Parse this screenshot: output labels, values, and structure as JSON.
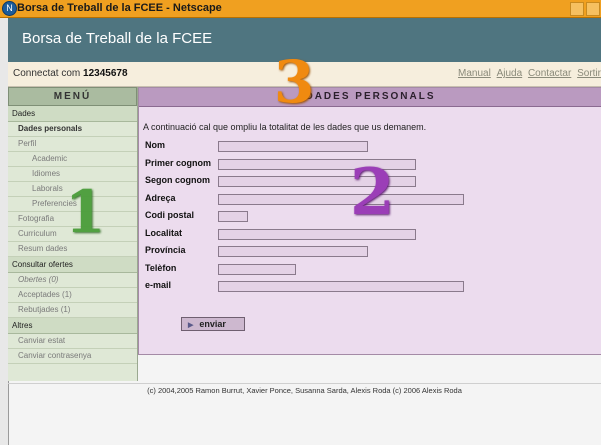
{
  "window": {
    "title": "Borsa de Treball de la FCEE - Netscape"
  },
  "app": {
    "title": "Borsa de Treball de la FCEE"
  },
  "infobar": {
    "connected_label": "Connectat com",
    "user_id": "12345678",
    "links": [
      "Manual",
      "Ajuda",
      "Contactar",
      "Sortir"
    ]
  },
  "sidebar": {
    "title": "MENÚ",
    "sections": [
      {
        "label": "Dades",
        "items": [
          {
            "label": "Dades personals",
            "level": 1,
            "active": true
          },
          {
            "label": "Perfil",
            "level": 1
          },
          {
            "label": "Academic",
            "level": 2
          },
          {
            "label": "Idiomes",
            "level": 2
          },
          {
            "label": "Laborals",
            "level": 2
          },
          {
            "label": "Preferencies",
            "level": 2
          },
          {
            "label": "Fotografia",
            "level": 1
          },
          {
            "label": "Curriculum",
            "level": 1
          },
          {
            "label": "Resum dades",
            "level": 1
          }
        ]
      },
      {
        "label": "Consultar ofertes",
        "items": [
          {
            "label": "Obertes (0)",
            "level": 1,
            "italic": true
          },
          {
            "label": "Acceptades (1)",
            "level": 1
          },
          {
            "label": "Rebutjades (1)",
            "level": 1
          }
        ]
      },
      {
        "label": "Altres",
        "items": [
          {
            "label": "Canviar estat",
            "level": 1
          },
          {
            "label": "Canviar contrasenya",
            "level": 1
          }
        ]
      }
    ]
  },
  "main": {
    "heading": "DADES PERSONALS",
    "intro": "A continuació cal que ompliu la totalitat de les dades que us demanem.",
    "fields": [
      {
        "label": "Nom",
        "value": ""
      },
      {
        "label": "Primer cognom",
        "value": ""
      },
      {
        "label": "Segon cognom",
        "value": ""
      },
      {
        "label": "Adreça",
        "value": ""
      },
      {
        "label": "Codi postal",
        "value": ""
      },
      {
        "label": "Localitat",
        "value": ""
      },
      {
        "label": "Província",
        "value": ""
      },
      {
        "label": "Telèfon",
        "value": ""
      },
      {
        "label": "e-mail",
        "value": ""
      }
    ],
    "submit_label": "enviar"
  },
  "footer": {
    "text": "(c) 2004,2005 Ramon Burrut, Xavier Ponce, Susanna Sarda, Alexis Roda (c) 2006 Alexis Roda"
  },
  "annotations": {
    "one": "1",
    "two": "2",
    "three": "3"
  },
  "colors": {
    "titlebar": "#f0a020",
    "banner": "#4f7580",
    "sidebar": "#dfe8d6",
    "content": "#ecdcee",
    "content_header": "#ba9ac0"
  }
}
